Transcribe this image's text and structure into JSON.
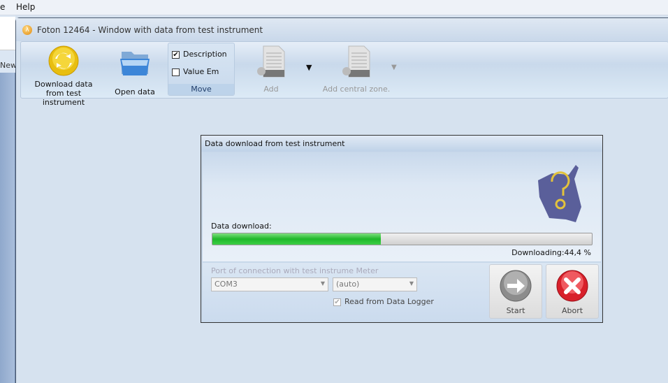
{
  "menu": {
    "partial_item": "e",
    "help": "Help"
  },
  "left_panel": {
    "new_label": "New"
  },
  "window": {
    "title": "Foton 12464 - Window with data from test instrument"
  },
  "toolbar": {
    "download": "Download data from test instrument",
    "open": "Open data",
    "move_group": {
      "label": "Move",
      "description": {
        "label": "Description",
        "checked": true
      },
      "value_em": {
        "label": "Value Em",
        "checked": false
      }
    },
    "add": {
      "label": "Add",
      "enabled": false
    },
    "add_central_zone": {
      "label": "Add central zone.",
      "enabled": false
    }
  },
  "dialog": {
    "title": "Data download from test instrument",
    "progress_label": "Data download:",
    "progress_percent": 44.4,
    "status": "Downloading:44,4 %",
    "port_label": "Port of connection with test instrume Meter",
    "port_value": "COM3",
    "speed_value": "(auto)",
    "read_logger": {
      "label": "Read from Data Logger",
      "checked": true,
      "enabled": false
    },
    "start": "Start",
    "abort": "Abort"
  },
  "colors": {
    "progress": "#2cc236",
    "abort": "#d8202a"
  }
}
